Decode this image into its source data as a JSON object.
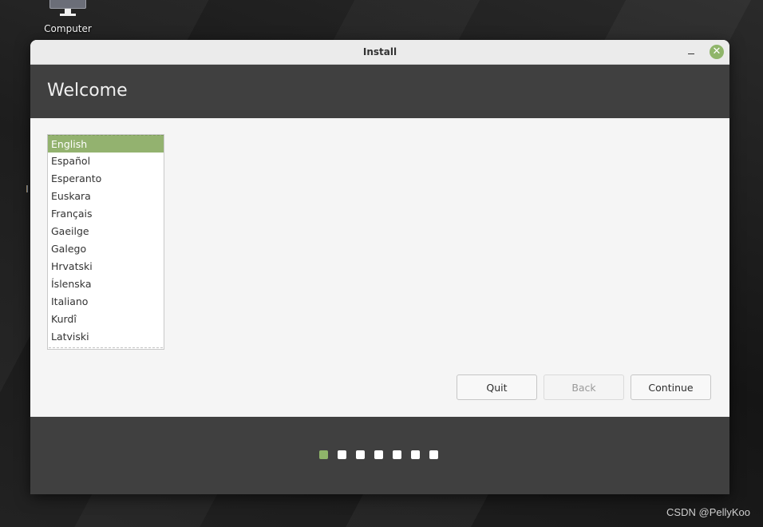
{
  "desktop": {
    "icons": [
      {
        "label": "Computer",
        "icon": "computer-icon"
      }
    ],
    "watermark": "CSDN @PellyKoo"
  },
  "window": {
    "title": "Install",
    "controls": {
      "minimize_icon": "minimize-icon",
      "close_icon": "close-icon",
      "close_glyph": "✕"
    },
    "header": {
      "title": "Welcome"
    },
    "language_list": {
      "selected": "English",
      "items": [
        "English",
        "Español",
        "Esperanto",
        "Euskara",
        "Français",
        "Gaeilge",
        "Galego",
        "Hrvatski",
        "Íslenska",
        "Italiano",
        "Kurdî",
        "Latviski"
      ]
    },
    "buttons": {
      "quit": "Quit",
      "back": "Back",
      "continue": "Continue"
    },
    "progress": {
      "current_step": 1,
      "total_steps": 7
    },
    "colors": {
      "accent": "#8fb56a",
      "header_bg": "#404040"
    }
  }
}
